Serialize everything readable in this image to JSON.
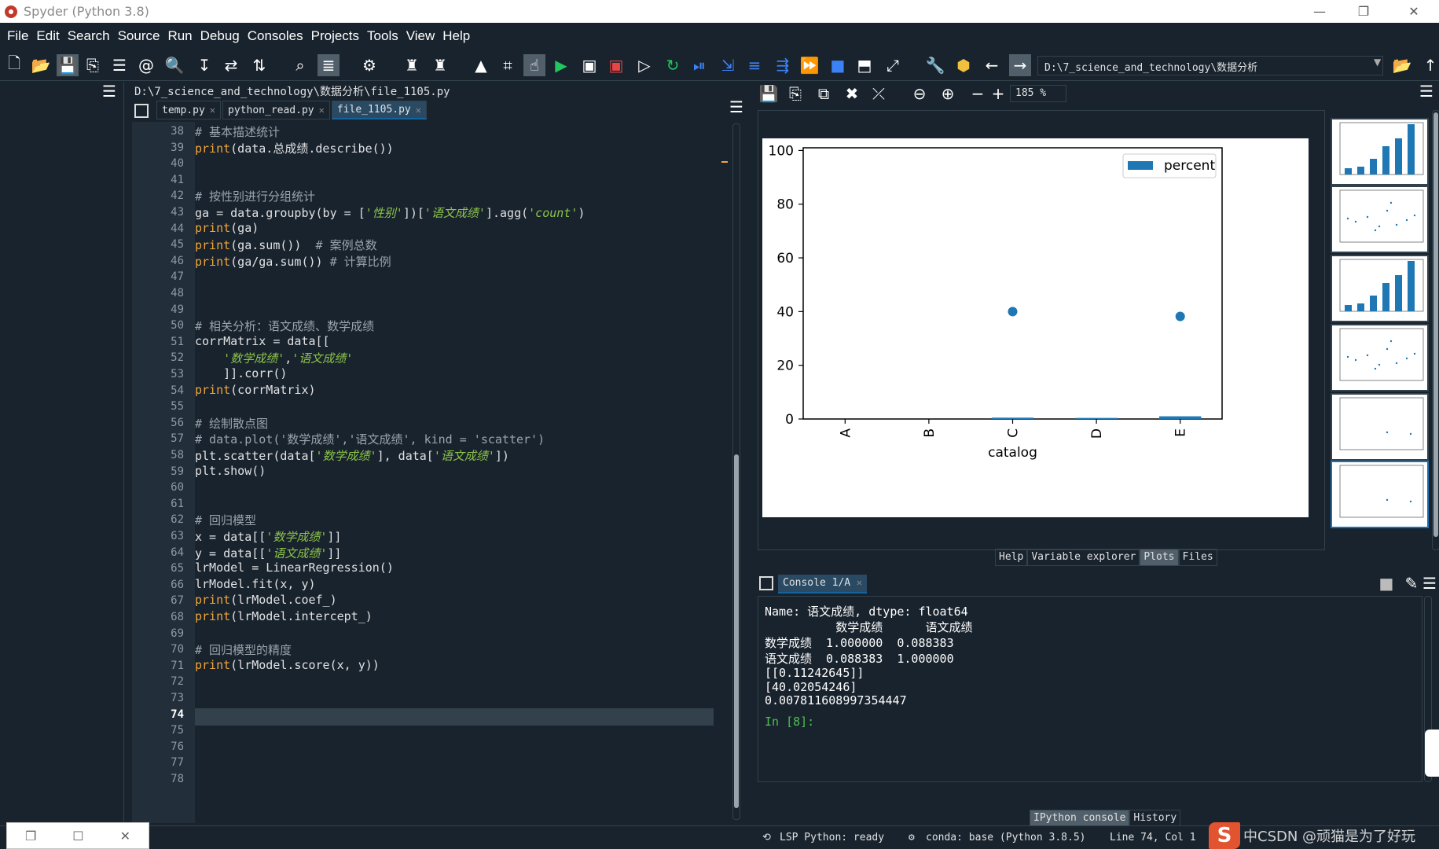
{
  "window": {
    "title": "Spyder (Python 3.8)",
    "minimize": "—",
    "maximize": "❐",
    "close": "✕"
  },
  "menu": [
    "File",
    "Edit",
    "Search",
    "Source",
    "Run",
    "Debug",
    "Consoles",
    "Projects",
    "Tools",
    "View",
    "Help"
  ],
  "toolbar": {
    "working_dir": "D:\\7_science_and_technology\\数据分析"
  },
  "editor": {
    "file_path": "D:\\7_science_and_technology\\数据分析\\file_1105.py",
    "tabs": [
      {
        "label": "temp.py",
        "active": false
      },
      {
        "label": "python_read.py",
        "active": false
      },
      {
        "label": "file_1105.py",
        "active": true
      }
    ],
    "current_line": 74,
    "lines": [
      {
        "n": 38,
        "t": [
          [
            "com",
            "# 基本描述统计"
          ]
        ]
      },
      {
        "n": 39,
        "t": [
          [
            "fn",
            "print"
          ],
          [
            "txt",
            "(data.总成绩.describe())"
          ]
        ]
      },
      {
        "n": 40,
        "t": []
      },
      {
        "n": 41,
        "t": []
      },
      {
        "n": 42,
        "t": [
          [
            "com",
            "# 按性别进行分组统计"
          ]
        ]
      },
      {
        "n": 43,
        "t": [
          [
            "txt",
            "ga = data.groupby(by = ["
          ],
          [
            "str",
            "'性别'"
          ],
          [
            "txt",
            "])["
          ],
          [
            "str",
            "'语文成绩'"
          ],
          [
            "txt",
            "].agg("
          ],
          [
            "str",
            "'count'"
          ],
          [
            "txt",
            ")"
          ]
        ]
      },
      {
        "n": 44,
        "t": [
          [
            "fn",
            "print"
          ],
          [
            "txt",
            "(ga)"
          ]
        ]
      },
      {
        "n": 45,
        "t": [
          [
            "fn",
            "print"
          ],
          [
            "txt",
            "(ga.sum())  "
          ],
          [
            "com",
            "# 案例总数"
          ]
        ]
      },
      {
        "n": 46,
        "t": [
          [
            "fn",
            "print"
          ],
          [
            "txt",
            "(ga/ga.sum()) "
          ],
          [
            "com",
            "# 计算比例"
          ]
        ]
      },
      {
        "n": 47,
        "t": []
      },
      {
        "n": 48,
        "t": []
      },
      {
        "n": 49,
        "t": []
      },
      {
        "n": 50,
        "t": [
          [
            "com",
            "# 相关分析：语文成绩、数学成绩"
          ]
        ]
      },
      {
        "n": 51,
        "t": [
          [
            "txt",
            "corrMatrix = data[["
          ]
        ]
      },
      {
        "n": 52,
        "t": [
          [
            "txt",
            "    "
          ],
          [
            "str",
            "'数学成绩'"
          ],
          [
            "txt",
            ","
          ],
          [
            "str",
            "'语文成绩'"
          ]
        ]
      },
      {
        "n": 53,
        "t": [
          [
            "txt",
            "    ]].corr()"
          ]
        ]
      },
      {
        "n": 54,
        "t": [
          [
            "fn",
            "print"
          ],
          [
            "txt",
            "(corrMatrix)"
          ]
        ]
      },
      {
        "n": 55,
        "t": []
      },
      {
        "n": 56,
        "t": [
          [
            "com",
            "# 绘制散点图"
          ]
        ]
      },
      {
        "n": 57,
        "t": [
          [
            "com",
            "# data.plot('数学成绩','语文成绩', kind = 'scatter')"
          ]
        ]
      },
      {
        "n": 58,
        "t": [
          [
            "txt",
            "plt.scatter(data["
          ],
          [
            "str",
            "'数学成绩'"
          ],
          [
            "txt",
            "], data["
          ],
          [
            "str",
            "'语文成绩'"
          ],
          [
            "txt",
            "])"
          ]
        ]
      },
      {
        "n": 59,
        "t": [
          [
            "txt",
            "plt.show()"
          ]
        ]
      },
      {
        "n": 60,
        "t": []
      },
      {
        "n": 61,
        "t": []
      },
      {
        "n": 62,
        "t": [
          [
            "com",
            "# 回归模型"
          ]
        ]
      },
      {
        "n": 63,
        "t": [
          [
            "txt",
            "x = data[["
          ],
          [
            "str",
            "'数学成绩'"
          ],
          [
            "txt",
            "]]"
          ]
        ]
      },
      {
        "n": 64,
        "t": [
          [
            "txt",
            "y = data[["
          ],
          [
            "str",
            "'语文成绩'"
          ],
          [
            "txt",
            "]]"
          ]
        ]
      },
      {
        "n": 65,
        "t": [
          [
            "txt",
            "lrModel = LinearRegression()"
          ]
        ]
      },
      {
        "n": 66,
        "t": [
          [
            "txt",
            "lrModel.fit(x, y)"
          ]
        ]
      },
      {
        "n": 67,
        "t": [
          [
            "fn",
            "print"
          ],
          [
            "txt",
            "(lrModel.coef_)"
          ]
        ]
      },
      {
        "n": 68,
        "t": [
          [
            "fn",
            "print"
          ],
          [
            "txt",
            "(lrModel.intercept_)"
          ]
        ]
      },
      {
        "n": 69,
        "t": []
      },
      {
        "n": 70,
        "t": [
          [
            "com",
            "# 回归模型的精度"
          ]
        ]
      },
      {
        "n": 71,
        "t": [
          [
            "fn",
            "print"
          ],
          [
            "txt",
            "(lrModel.score(x, y))"
          ]
        ]
      },
      {
        "n": 72,
        "t": []
      },
      {
        "n": 73,
        "t": []
      },
      {
        "n": 74,
        "t": []
      },
      {
        "n": 75,
        "t": []
      },
      {
        "n": 76,
        "t": []
      },
      {
        "n": 77,
        "t": []
      },
      {
        "n": 78,
        "t": []
      }
    ]
  },
  "plots": {
    "zoom": "185 %",
    "tabs": [
      {
        "label": "Help",
        "active": false
      },
      {
        "label": "Variable explorer",
        "active": false
      },
      {
        "label": "Plots",
        "active": true
      },
      {
        "label": "Files",
        "active": false
      }
    ]
  },
  "chart_data": {
    "type": "bar",
    "categories": [
      "A",
      "B",
      "C",
      "D",
      "E"
    ],
    "series": [
      {
        "name": "percent",
        "values": [
          0,
          0,
          0.5,
          0.4,
          1.0
        ]
      }
    ],
    "scatter_points": [
      [
        2,
        40
      ],
      [
        4,
        38.2
      ]
    ],
    "xlabel": "catalog",
    "ylabel": "",
    "yticks": [
      0,
      20,
      40,
      60,
      80,
      100
    ],
    "ylim": [
      0,
      101
    ],
    "legend": "top-right",
    "bar_color": "#1f77b4"
  },
  "console": {
    "tab_label": "Console 1/A",
    "output": [
      "Name: 语文成绩, dtype: float64",
      "          数学成绩      语文成绩",
      "数学成绩  1.000000  0.088383",
      "语文成绩  0.088383  1.000000",
      "[[0.11242645]]",
      "[40.02054246]",
      "0.007811608997354447"
    ],
    "prompt": "In [8]:",
    "bottom_tabs": [
      {
        "label": "IPython console",
        "active": true
      },
      {
        "label": "History",
        "active": false
      }
    ]
  },
  "status": {
    "lsp": "LSP Python: ready",
    "conda": "conda: base (Python 3.8.5)",
    "position": "Line 74, Col 1"
  },
  "watermark": {
    "logo": "S",
    "text": "中CSDN @顽猫是为了好玩"
  }
}
